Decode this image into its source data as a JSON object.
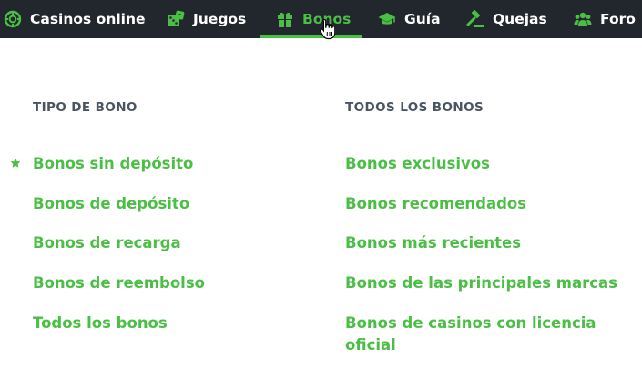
{
  "colors": {
    "accent": "#4bbf45",
    "nav_bg": "#22272e",
    "heading": "#4a5563"
  },
  "nav": {
    "items": [
      {
        "label": "Casinos online",
        "icon": "chip-icon"
      },
      {
        "label": "Juegos",
        "icon": "dice-icon"
      },
      {
        "label": "Bonos",
        "icon": "gift-icon",
        "active": true
      },
      {
        "label": "Guía",
        "icon": "graduation-cap-icon"
      },
      {
        "label": "Quejas",
        "icon": "gavel-icon"
      },
      {
        "label": "Foro",
        "icon": "users-icon"
      }
    ]
  },
  "menu": {
    "left": {
      "heading": "TIPO DE BONO",
      "links": [
        "Bonos sin depósito",
        "Bonos de depósito",
        "Bonos de recarga",
        "Bonos de reembolso",
        "Todos los bonos"
      ]
    },
    "right": {
      "heading": "TODOS LOS BONOS",
      "links": [
        "Bonos exclusivos",
        "Bonos recomendados",
        "Bonos más recientes",
        "Bonos de las principales marcas",
        "Bonos de casinos con licencia oficial"
      ]
    }
  }
}
